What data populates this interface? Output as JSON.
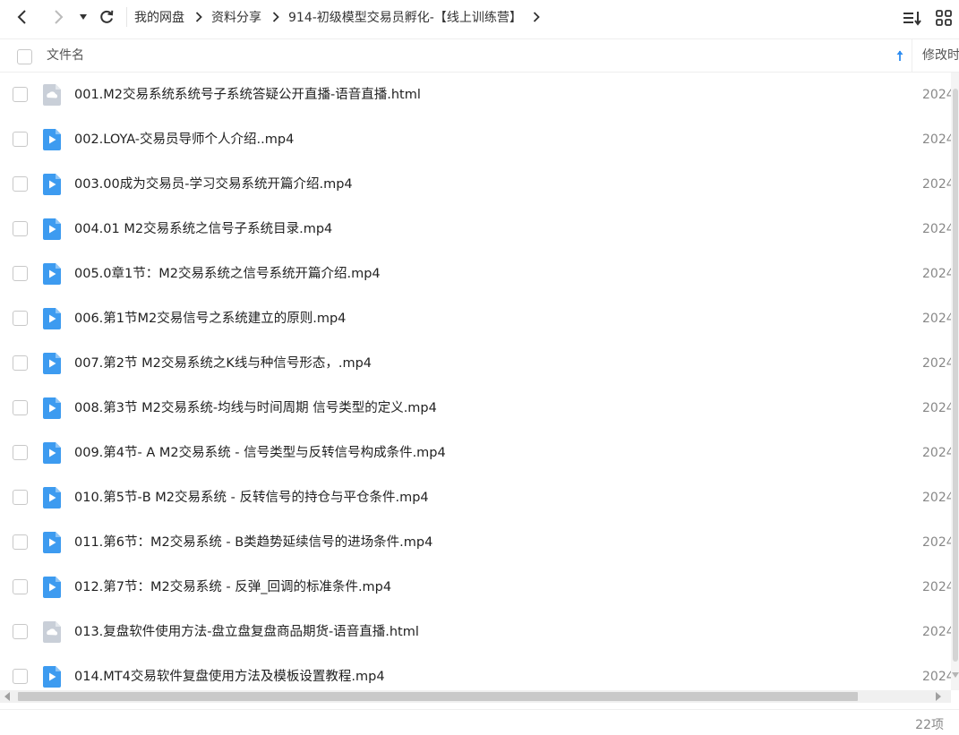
{
  "toolbar": {
    "breadcrumbs": [
      "我的网盘",
      "资料分享",
      "914-初级模型交易员孵化-【线上训练营】"
    ]
  },
  "header": {
    "name_column": "文件名",
    "time_column": "修改时"
  },
  "files": [
    {
      "name": "001.M2交易系统系统号子系统答疑公开直播-语音直播.html",
      "type": "html",
      "time": "2024"
    },
    {
      "name": "002.LOYA-交易员导师个人介绍..mp4",
      "type": "video",
      "time": "2024"
    },
    {
      "name": "003.00成为交易员-学习交易系统开篇介绍.mp4",
      "type": "video",
      "time": "2024"
    },
    {
      "name": "004.01 M2交易系统之信号子系统目录.mp4",
      "type": "video",
      "time": "2024"
    },
    {
      "name": "005.0章1节：M2交易系统之信号系统开篇介绍.mp4",
      "type": "video",
      "time": "2024"
    },
    {
      "name": "006.第1节M2交易信号之系统建立的原则.mp4",
      "type": "video",
      "time": "2024"
    },
    {
      "name": "007.第2节 M2交易系统之K线与种信号形态，.mp4",
      "type": "video",
      "time": "2024"
    },
    {
      "name": "008.第3节 M2交易系统-均线与时间周期 信号类型的定义.mp4",
      "type": "video",
      "time": "2024"
    },
    {
      "name": "009.第4节- A M2交易系统 - 信号类型与反转信号构成条件.mp4",
      "type": "video",
      "time": "2024"
    },
    {
      "name": "010.第5节-B M2交易系统 - 反转信号的持仓与平仓条件.mp4",
      "type": "video",
      "time": "2024"
    },
    {
      "name": "011.第6节：M2交易系统 - B类趋势延续信号的进场条件.mp4",
      "type": "video",
      "time": "2024"
    },
    {
      "name": "012.第7节：M2交易系统 - 反弹_回调的标准条件.mp4",
      "type": "video",
      "time": "2024"
    },
    {
      "name": "013.复盘软件使用方法-盘立盘复盘商品期货-语音直播.html",
      "type": "html",
      "time": "2024"
    },
    {
      "name": "014.MT4交易软件复盘使用方法及模板设置教程.mp4",
      "type": "video",
      "time": "2024"
    }
  ],
  "footer": {
    "item_count": "22项"
  },
  "colors": {
    "video_icon": "#3d9bf0",
    "html_icon": "#c9cfd8",
    "sort_arrow": "#2d8cf0"
  }
}
